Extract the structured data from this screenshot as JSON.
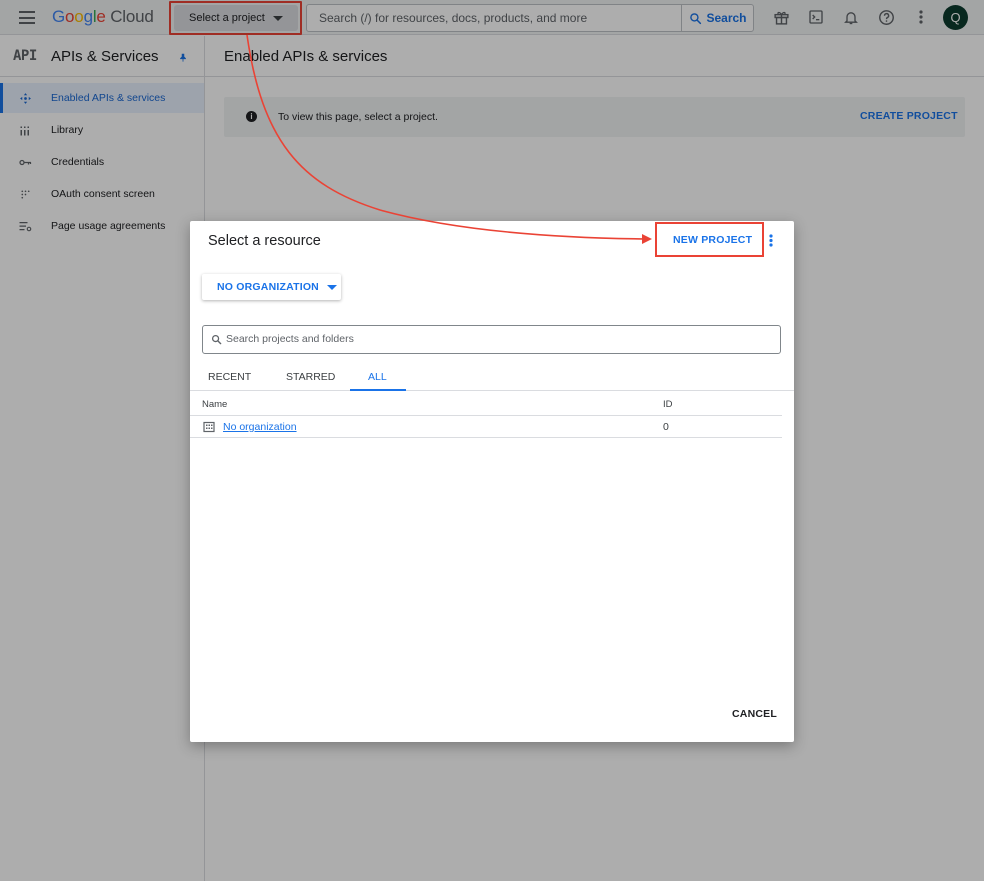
{
  "topbar": {
    "logo_google": "Google",
    "logo_cloud": "Cloud",
    "project_picker_label": "Select a project",
    "search_placeholder": "Search (/) for resources, docs, products, and more",
    "search_button_label": "Search",
    "icons": [
      "menu-icon",
      "gift-icon",
      "terminal-icon",
      "bell-icon",
      "help-icon",
      "more-vert-icon"
    ],
    "avatar_initial": "Q",
    "avatar_color": "#0d3b2e"
  },
  "sidebar": {
    "logo_text": "API",
    "title": "APIs & Services",
    "items": [
      {
        "label": "Enabled APIs & services",
        "icon": "diamond-arrows-icon",
        "active": true
      },
      {
        "label": "Library",
        "icon": "library-grid-icon",
        "active": false
      },
      {
        "label": "Credentials",
        "icon": "key-icon",
        "active": false
      },
      {
        "label": "OAuth consent screen",
        "icon": "dots-grid-icon",
        "active": false
      },
      {
        "label": "Page usage agreements",
        "icon": "settings-list-icon",
        "active": false
      }
    ]
  },
  "main": {
    "title": "Enabled APIs & services",
    "banner_text": "To view this page, select a project.",
    "banner_action": "CREATE PROJECT"
  },
  "dialog": {
    "title": "Select a resource",
    "new_project_label": "NEW PROJECT",
    "org_dropdown_label": "NO ORGANIZATION",
    "search_placeholder": "Search projects and folders",
    "tabs": [
      {
        "label": "RECENT",
        "active": false
      },
      {
        "label": "STARRED",
        "active": false
      },
      {
        "label": "ALL",
        "active": true
      }
    ],
    "columns": {
      "name": "Name",
      "id": "ID"
    },
    "rows": [
      {
        "name": "No organization",
        "id": "0",
        "icon": "building-icon"
      }
    ],
    "cancel_label": "CANCEL"
  },
  "colors": {
    "accent": "#1a73e8",
    "highlight": "#ea4335"
  }
}
